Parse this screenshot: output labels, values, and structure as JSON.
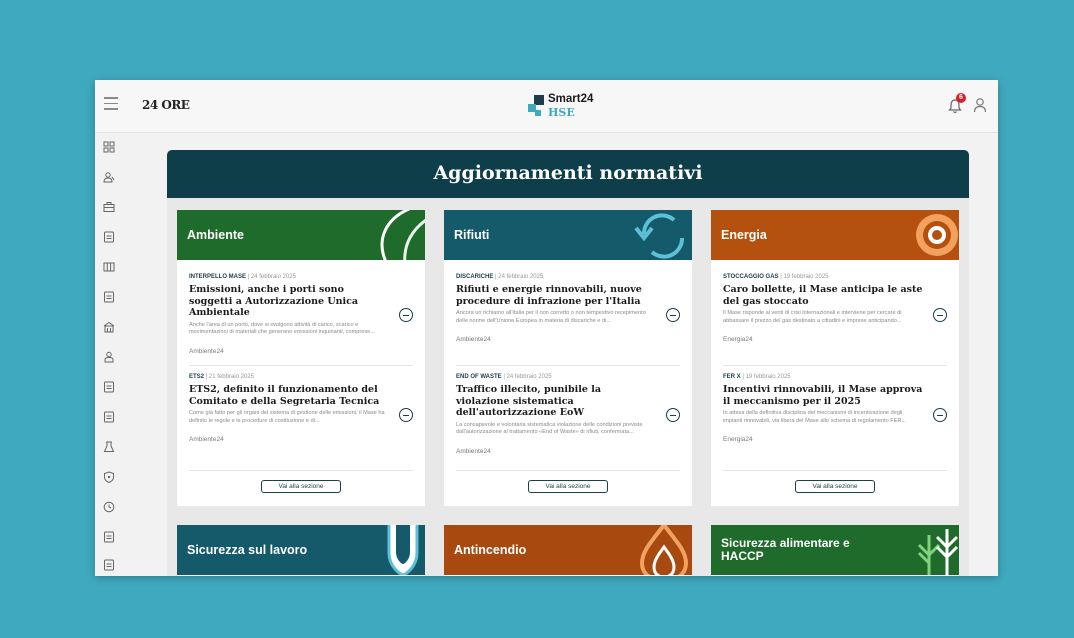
{
  "header": {
    "logo_text": "24 ORE",
    "brand_name": "Smart24",
    "brand_sub": "HSE",
    "notification_count": "6"
  },
  "sidebar": {
    "icons": [
      "grid-icon",
      "users-icon",
      "briefcase-icon",
      "document-icon",
      "columns-icon",
      "document-icon",
      "building-icon",
      "person-icon",
      "document-icon",
      "document-icon",
      "flask-icon",
      "shield-icon",
      "clock-icon",
      "document-icon",
      "document-icon"
    ]
  },
  "page": {
    "title": "Aggiornamenti normativi",
    "section_button": "Vai alla sezione"
  },
  "colors": {
    "background": "#3fa9bf",
    "banner": "#0d3e4a",
    "ambiente": "#1f6b2c",
    "rifiuti": "#145a6b",
    "energia": "#b5510f",
    "sicurezza_lavoro": "#145a6b",
    "antincendio": "#a84a10",
    "sicurezza_alimentare": "#1f6b2c"
  },
  "cards": [
    {
      "title": "Ambiente",
      "articles": [
        {
          "tag": "INTERPELLO MASE",
          "date": "24 febbraio 2025",
          "title": "Emissioni, anche i porti sono soggetti a Autorizzazione Unica Ambientale",
          "desc": "Anche l'area di un porto, dove si svolgono attività di carico, scarico e movimentazioni di materiali che generano emissioni inquinanti, comprese...",
          "source": "Ambiente24"
        },
        {
          "tag": "ETS2",
          "date": "21 febbraio 2025",
          "title": "ETS2, definito il funzionamento del Comitato e della Segretaria Tecnica",
          "desc": "Come già fatto per gli organi del sistema di gestione delle emissioni, il Mase ha definito le regole e le procedure di costituzione e di...",
          "source": "Ambiente24"
        }
      ]
    },
    {
      "title": "Rifiuti",
      "articles": [
        {
          "tag": "DISCARICHE",
          "date": "24 febbraio 2025",
          "title": "Rifiuti e energie rinnovabili, nuove procedure di infrazione per l'Italia",
          "desc": "Ancora un richiamo all'Italia per il non corretto o non tempestivo recepimento delle norme dell'Unione Europea in materia di discariche e di...",
          "source": "Ambiente24"
        },
        {
          "tag": "END OF WASTE",
          "date": "24 febbraio 2025",
          "title": "Traffico illecito, punibile la violazione sistematica dell'autorizzazione EoW",
          "desc": "La consapevole e volontaria sistematica violazione delle condizioni previste dall'autorizzazione al trattamento «End of Waste» di rifiuti, confermata...",
          "source": "Ambiente24"
        }
      ]
    },
    {
      "title": "Energia",
      "articles": [
        {
          "tag": "STOCCAGGIO GAS",
          "date": "19 febbraio 2025",
          "title": "Caro bollette, il Mase anticipa le aste del gas stoccato",
          "desc": "Il Mase risponde ai venti di crisi internazionali e interviene per cercare di abbassare il prezzo del gas destinato a cittadini e imprese anticipando...",
          "source": "Energia24"
        },
        {
          "tag": "FER X",
          "date": "19 febbraio 2025",
          "title": "Incentivi rinnovabili, il Mase approva il meccanismo per il 2025",
          "desc": "In attesa della definitiva disciplina dei meccanismi di incentivazione degli impianti rinnovabili, via libera del Mase allo schema di regolamento FER...",
          "source": "Energia24"
        }
      ]
    },
    {
      "title": "Sicurezza sul lavoro"
    },
    {
      "title": "Antincendio"
    },
    {
      "title": "Sicurezza alimentare e HACCP"
    }
  ]
}
